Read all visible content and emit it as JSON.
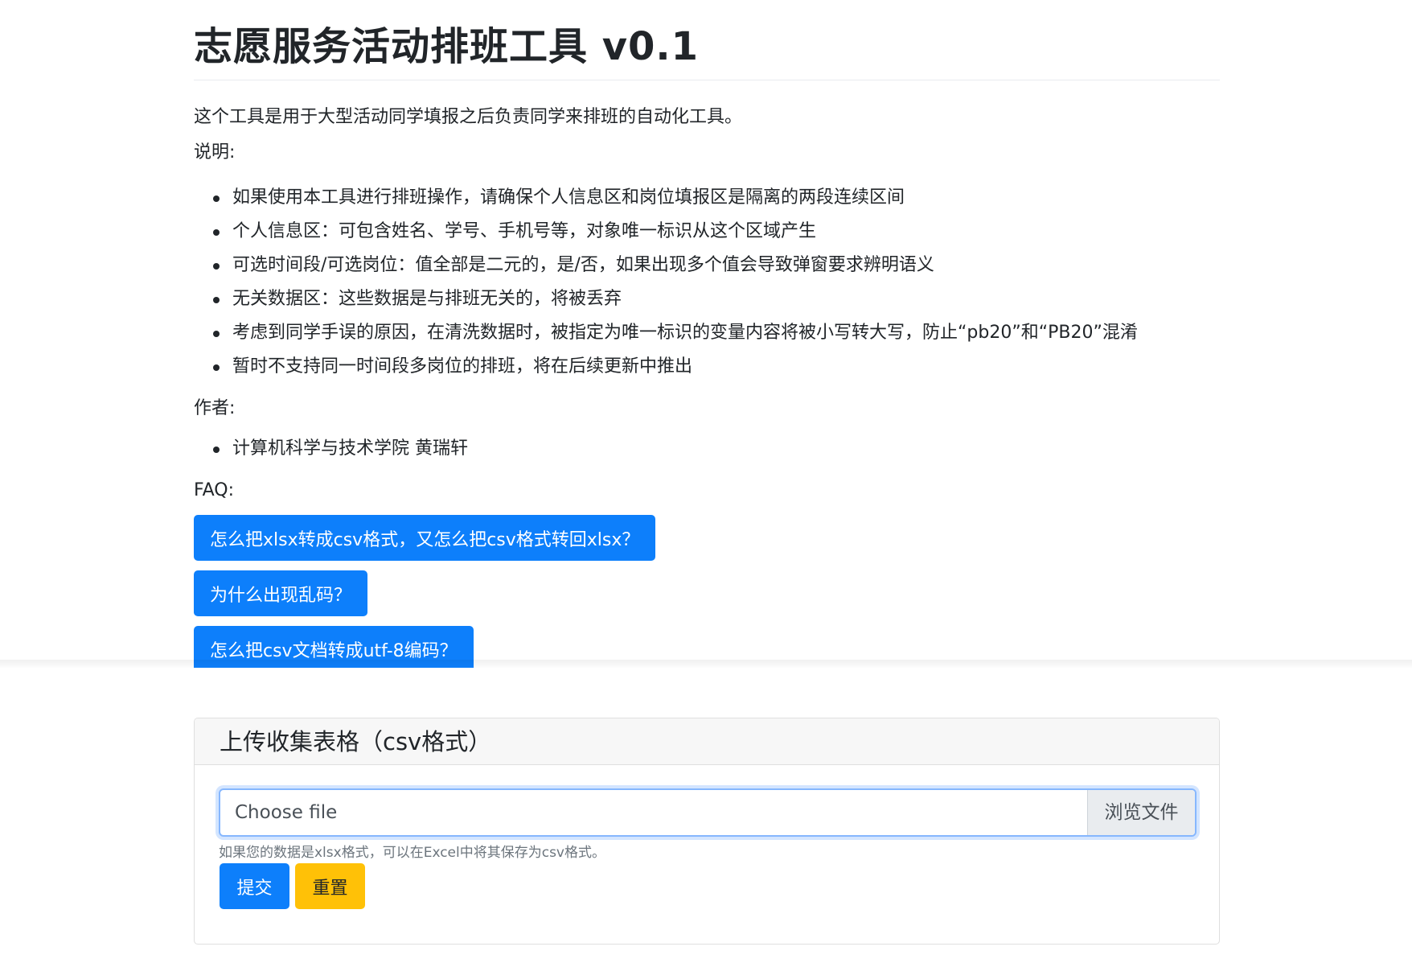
{
  "header": {
    "title": "志愿服务活动排班工具 v0.1"
  },
  "intro": "这个工具是用于大型活动同学填报之后负责同学来排班的自动化工具。",
  "notes": {
    "label": "说明:",
    "items": [
      "如果使用本工具进行排班操作，请确保个人信息区和岗位填报区是隔离的两段连续区间",
      "个人信息区：可包含姓名、学号、手机号等，对象唯一标识从这个区域产生",
      "可选时间段/可选岗位：值全部是二元的，是/否，如果出现多个值会导致弹窗要求辨明语义",
      "无关数据区：这些数据是与排班无关的，将被丢弃",
      "考虑到同学手误的原因，在清洗数据时，被指定为唯一标识的变量内容将被小写转大写，防止“pb20”和“PB20”混淆",
      "暂时不支持同一时间段多岗位的排班，将在后续更新中推出"
    ]
  },
  "author": {
    "label": "作者:",
    "items": [
      "计算机科学与技术学院 黄瑞轩"
    ]
  },
  "faq": {
    "label": "FAQ:",
    "buttons": [
      "怎么把xlsx转成csv格式，又怎么把csv格式转回xlsx？",
      "为什么出现乱码？",
      "怎么把csv文档转成utf-8编码？"
    ]
  },
  "upload": {
    "header": "上传收集表格（csv格式）",
    "file_placeholder": "Choose file",
    "browse_label": "浏览文件",
    "help": "如果您的数据是xlsx格式，可以在Excel中将其保存为csv格式。",
    "submit_label": "提交",
    "reset_label": "重置"
  },
  "colors": {
    "primary": "#0d7ffb",
    "warning": "#ffc107",
    "focus_border": "#86b7fe"
  }
}
